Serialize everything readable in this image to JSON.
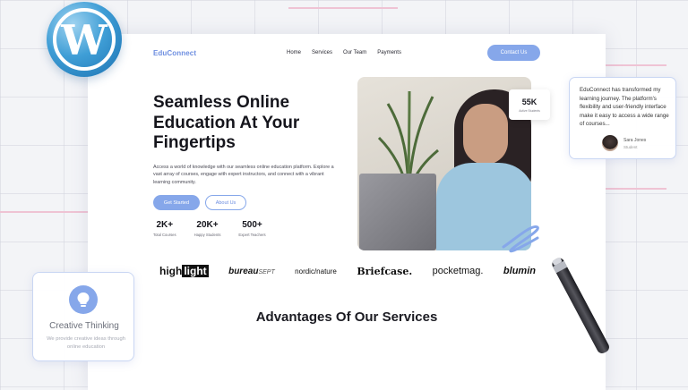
{
  "nav": {
    "brand": "EduConnect",
    "links": [
      "Home",
      "Services",
      "Our Team",
      "Payments"
    ],
    "contact_label": "Contact Us"
  },
  "hero": {
    "title": "Seamless Online Education At Your Fingertips",
    "description": "Access a world of knowledge with our seamless online education platform. Explore a vast array of courses, engage with expert instructors, and connect with a vibrant learning community.",
    "primary_button": "Get Started",
    "secondary_button": "About Us",
    "stats": [
      {
        "value": "2K+",
        "label": "Total Courses"
      },
      {
        "value": "20K+",
        "label": "Happy Students"
      },
      {
        "value": "500+",
        "label": "Expert Teachers"
      }
    ],
    "badge": {
      "value": "55K",
      "label": "Active Students"
    }
  },
  "partners": {
    "highlight_a": "high",
    "highlight_b": "light",
    "bureau_main": "bureau",
    "bureau_sub": "SEPT",
    "nordic": "nordic/nature",
    "briefcase": "Briefcase.",
    "pocketmag": "pocketmag.",
    "blumin": "blumin"
  },
  "advantages_title": "Advantages Of Our Services",
  "testimonial": {
    "text": "EduConnect has transformed my learning journey. The platform's flexibility and user-friendly interface make it easy to access a wide range of courses...",
    "author": "Sara Jones",
    "role": "Student"
  },
  "feature_card": {
    "title": "Creative Thinking",
    "description": "We provide creative ideas through online education"
  },
  "colors": {
    "accent": "#86a7ea",
    "brand_text": "#6d8ee0",
    "card_border": "#c9d6f3"
  },
  "icons": [
    "wordpress-logo-icon",
    "lightbulb-icon",
    "scribble-decoration-icon",
    "pen-icon"
  ]
}
